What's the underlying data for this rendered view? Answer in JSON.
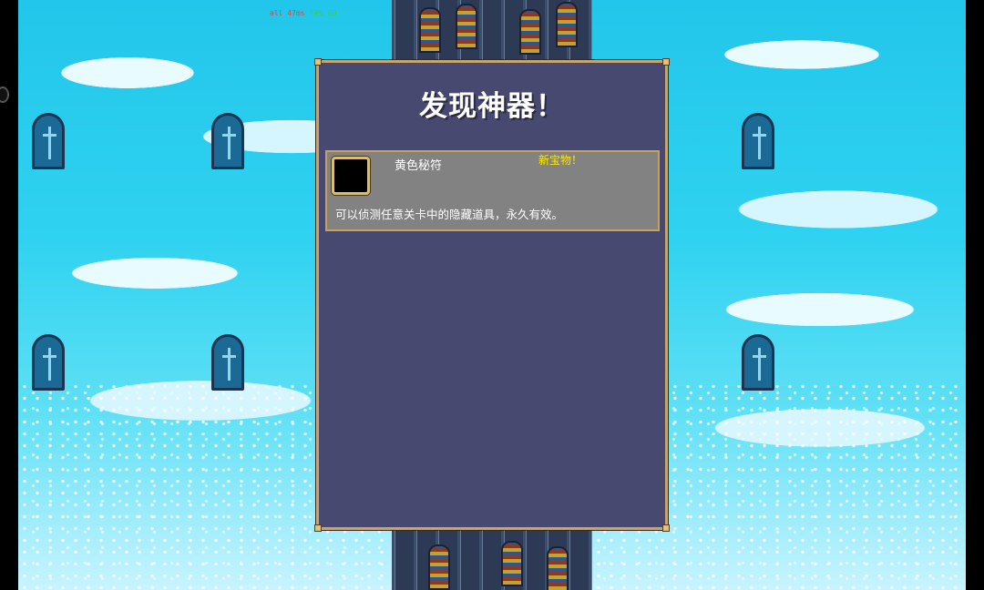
{
  "debug_overlay": {
    "ping": "all 47ms",
    "fps": "FPS 60"
  },
  "dialog": {
    "title": "发现神器！",
    "item": {
      "name": "黄色秘符",
      "badge": "新宝物！",
      "description": "可以侦测任意关卡中的隐藏道具，永久有效。",
      "icon": "empty-item-slot-icon"
    }
  },
  "colors": {
    "sky": "#2fd2f0",
    "dialog_bg": "#484970",
    "dialog_border": "#caa46a",
    "item_bg": "#828282",
    "badge_text": "#ffe800"
  }
}
